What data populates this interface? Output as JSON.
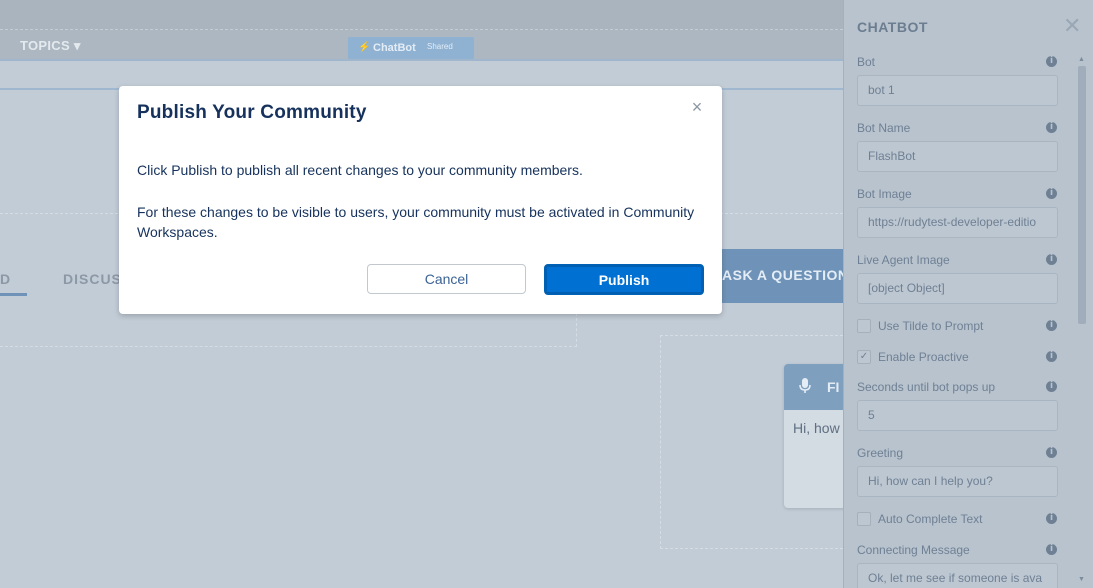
{
  "canvas": {
    "nav": {
      "topics_label": "TOPICS ▾",
      "chatbot_tag_label": "ChatBot",
      "chatbot_tag_badge": "Shared"
    },
    "tabs": {
      "feed": "D",
      "discussions": "DISCUS"
    },
    "ask_button_label": "ASK A QUESTION",
    "chat_window": {
      "title": "FI",
      "message": "Hi, how"
    }
  },
  "modal": {
    "title": "Publish Your Community",
    "close_glyph": "×",
    "paragraph_1": "Click Publish to publish all recent changes to your community members.",
    "paragraph_2": "For these changes to be visible to users, your community must be activated in Community Workspaces.",
    "cancel_label": "Cancel",
    "publish_label": "Publish"
  },
  "panel": {
    "title": "CHATBOT",
    "close_glyph": "✕",
    "fields": [
      {
        "label": "Bot",
        "value": "bot 1"
      },
      {
        "label": "Bot Name",
        "value": "FlashBot"
      },
      {
        "label": "Bot Image",
        "value": "https://rudytest-developer-editio"
      },
      {
        "label": "Live Agent Image",
        "value": "[object Object]"
      },
      {
        "label": "Seconds until bot pops up",
        "value": "5"
      },
      {
        "label": "Greeting",
        "value": "Hi, how can I help you?"
      },
      {
        "label": "Connecting Message",
        "value": "Ok, let me see if someone is ava"
      }
    ],
    "checkboxes": [
      {
        "label": "Use Tilde to Prompt",
        "checked": false,
        "glyph": ""
      },
      {
        "label": "Enable Proactive",
        "checked": true,
        "glyph": "✓"
      },
      {
        "label": "Auto Complete Text",
        "checked": false,
        "glyph": ""
      }
    ]
  },
  "colors": {
    "brand_blue": "#0070d2",
    "modal_text": "#16325c",
    "overlay": "#b8c3cd"
  }
}
